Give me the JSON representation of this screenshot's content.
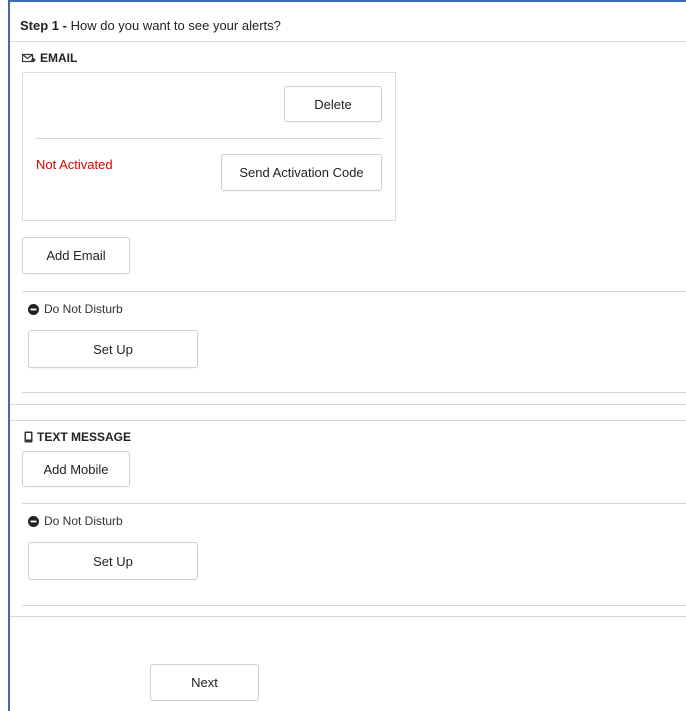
{
  "step": {
    "number_label": "Step 1 -",
    "question": "How do you want to see your alerts?"
  },
  "email": {
    "section_label": "EMAIL",
    "icon": "envelope-icon",
    "card": {
      "delete_label": "Delete",
      "status_text": "Not Activated",
      "status_color": "#e00000",
      "send_code_label": "Send Activation Code"
    },
    "add_label": "Add Email",
    "dnd": {
      "label": "Do Not Disturb",
      "icon": "minus-circle-icon",
      "setup_label": "Set Up"
    }
  },
  "text_message": {
    "section_label": "TEXT MESSAGE",
    "icon": "mobile-phone-icon",
    "add_label": "Add Mobile",
    "dnd": {
      "label": "Do Not Disturb",
      "icon": "minus-circle-icon",
      "setup_label": "Set Up"
    }
  },
  "footer": {
    "next_label": "Next"
  },
  "colors": {
    "frame_border": "#3b6db3",
    "divider": "#d6d6d6"
  }
}
